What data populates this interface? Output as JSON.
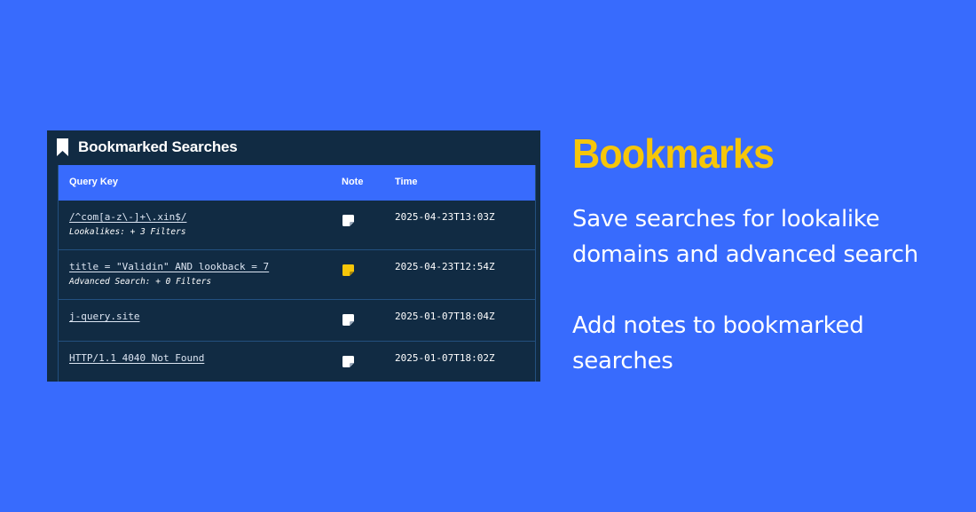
{
  "panel": {
    "title": "Bookmarked Searches",
    "icon": "bookmark-icon",
    "colors": {
      "panel_bg": "#112b43",
      "header_row_bg": "#386bfd",
      "note_empty": "#ffffff",
      "note_filled": "#f6c609"
    }
  },
  "table": {
    "headers": {
      "query_key": "Query Key",
      "note": "Note",
      "time": "Time"
    },
    "rows": [
      {
        "query": "/^com[a-z\\-]+\\.xin$/",
        "subtitle": "Lookalikes: + 3 Filters",
        "note_icon": "note-icon",
        "has_note": false,
        "time": "2025-04-23T13:03Z"
      },
      {
        "query": "title = \"Validin\" AND lookback = 7",
        "subtitle": "Advanced Search: + 0 Filters",
        "note_icon": "note-icon",
        "has_note": true,
        "time": "2025-04-23T12:54Z"
      },
      {
        "query": "j-query.site",
        "subtitle": "",
        "note_icon": "note-icon",
        "has_note": false,
        "time": "2025-01-07T18:04Z"
      },
      {
        "query": "HTTP/1.1 4040 Not Found",
        "subtitle": "",
        "note_icon": "note-icon",
        "has_note": false,
        "time": "2025-01-07T18:02Z"
      }
    ]
  },
  "promo": {
    "heading": "Bookmarks",
    "line1": "Save searches for lookalike domains and advanced search",
    "line2": "Add notes to bookmarked searches",
    "colors": {
      "background": "#386bfd",
      "heading": "#f6c609",
      "text": "#ffffff"
    }
  }
}
